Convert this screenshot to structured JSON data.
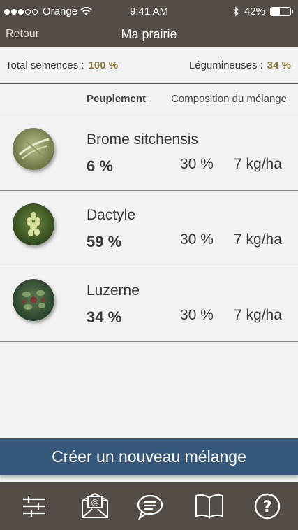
{
  "status_bar": {
    "carrier": "Orange",
    "time": "9:41 AM",
    "battery": "42%",
    "battery_level": 0.42,
    "signal_bars": 3,
    "signal_total": 5
  },
  "nav": {
    "back_label": "Retour",
    "title": "Ma prairie"
  },
  "totals": {
    "seeds_label": "Total semences :",
    "seeds_value": "100 %",
    "legumes_label": "Légumineuses :",
    "legumes_value": "34 %"
  },
  "columns": {
    "stand": "Peuplement",
    "mix": "Composition du mélange"
  },
  "species": [
    {
      "name": "Brome sitchensis",
      "stand": "6 %",
      "mix": "30 %",
      "dose": "7 kg/ha",
      "thumb_icon": "brome-photo"
    },
    {
      "name": "Dactyle",
      "stand": "59 %",
      "mix": "30 %",
      "dose": "7 kg/ha",
      "thumb_icon": "dactyle-photo"
    },
    {
      "name": "Luzerne",
      "stand": "34 %",
      "mix": "30 %",
      "dose": "7 kg/ha",
      "thumb_icon": "luzerne-photo"
    }
  ],
  "create_button": "Créer un nouveau mélange",
  "tabbar": {
    "icons": [
      "sliders-icon",
      "email-icon",
      "chat-icon",
      "book-icon",
      "help-icon"
    ]
  },
  "colors": {
    "header_bg": "#544c47",
    "accent_gold": "#8b7838",
    "button_blue": "#35577a"
  }
}
